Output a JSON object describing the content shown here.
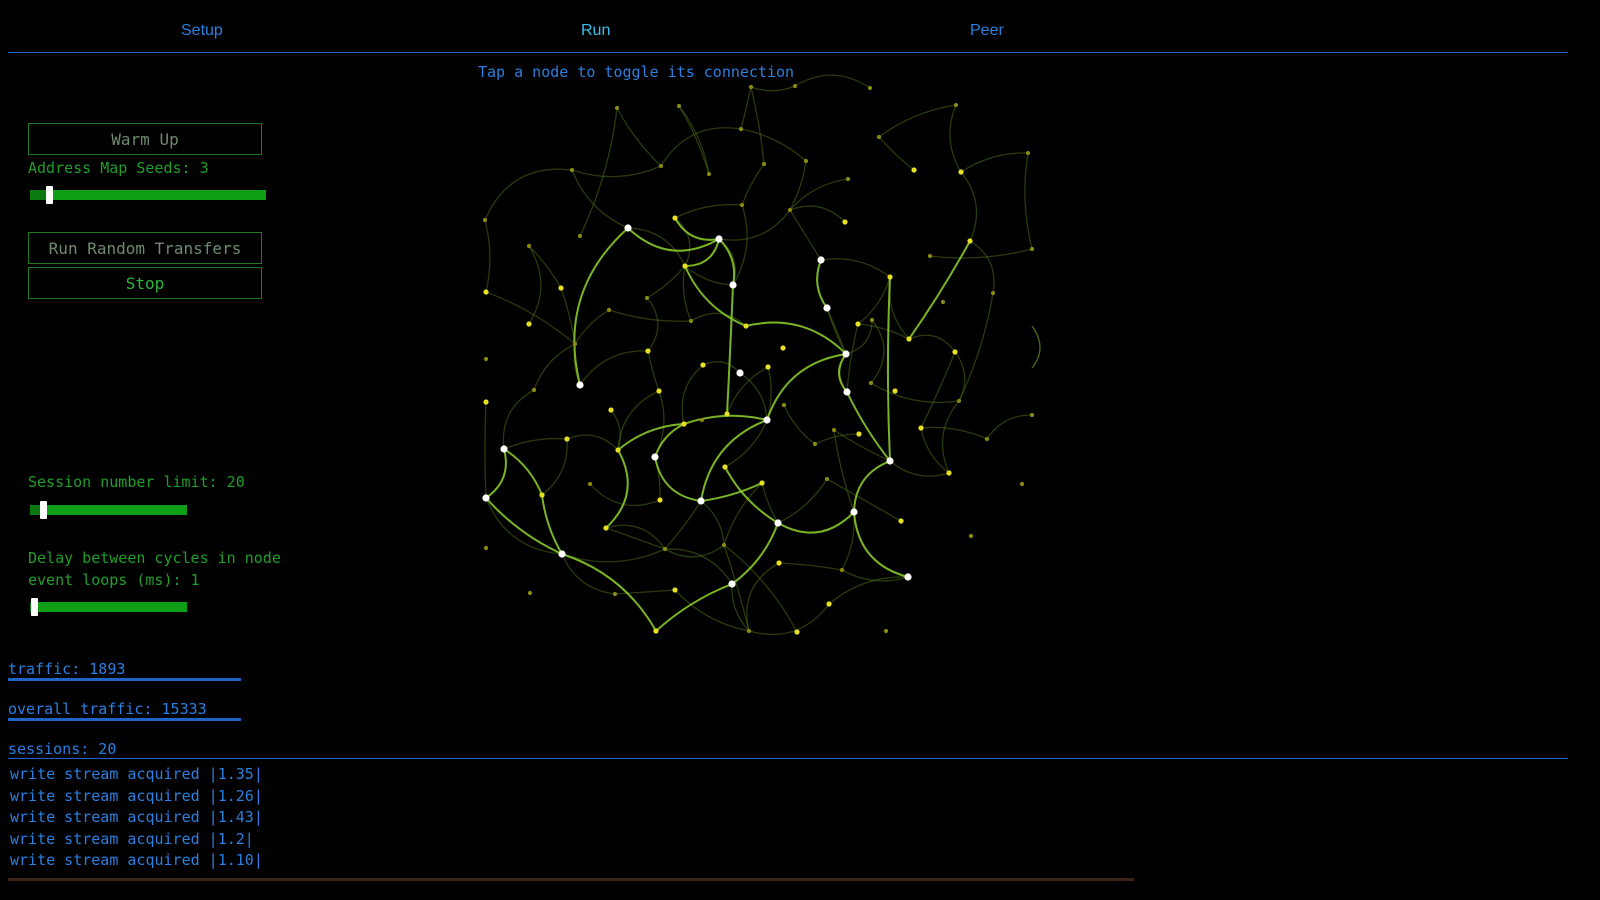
{
  "tabs": [
    {
      "label": "Setup",
      "active": false
    },
    {
      "label": "Run",
      "active": true
    },
    {
      "label": "Peer",
      "active": false
    }
  ],
  "hint": "Tap a node to toggle its connection",
  "controls": {
    "warm_up": "Warm Up",
    "address_map_label": "Address Map Seeds: 3",
    "address_map_seeds": 3,
    "run_random": "Run Random Transfers",
    "stop": "Stop",
    "session_limit_label": "Session number limit: 20",
    "session_limit": 20,
    "delay_label_1": "Delay between cycles in node",
    "delay_label_2": "event loops (ms): 1",
    "delay_ms": 1
  },
  "stats": {
    "traffic": "traffic: 1893",
    "overall_traffic": "overall traffic: 15333",
    "sessions": "sessions: 20"
  },
  "log": [
    "write stream acquired |1.35|",
    "write stream acquired |1.26|",
    "write stream acquired |1.43|",
    "write stream acquired |1.2|",
    "write stream acquired |1.10|"
  ],
  "colors": {
    "accent_blue": "#2a7fe0",
    "accent_green": "#1f9e2a",
    "node_white": "#ffffff",
    "node_yellow": "#e8e020",
    "node_olive": "#8a8a10",
    "edge_bright": "#8fd42a",
    "edge_dim": "#2a3d10"
  }
}
